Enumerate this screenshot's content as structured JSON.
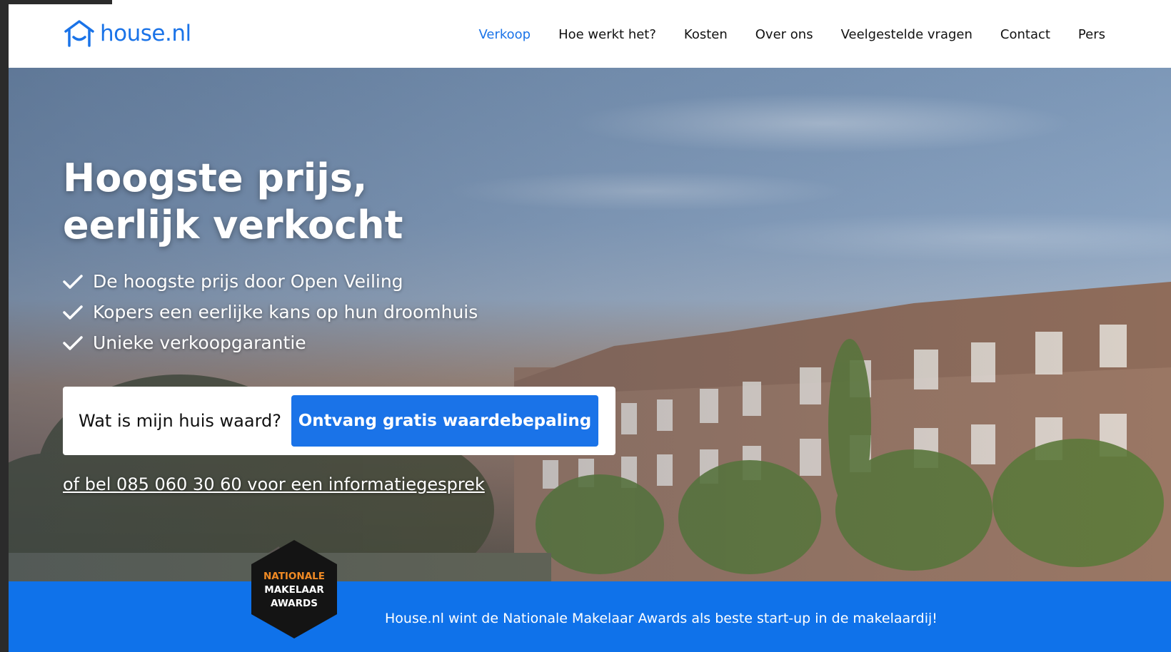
{
  "logo": {
    "text": "house.nl",
    "icon": "house-icon"
  },
  "nav": {
    "items": [
      {
        "label": "Verkoop",
        "active": true
      },
      {
        "label": "Hoe werkt het?",
        "active": false
      },
      {
        "label": "Kosten",
        "active": false
      },
      {
        "label": "Over ons",
        "active": false
      },
      {
        "label": "Veelgestelde vragen",
        "active": false
      },
      {
        "label": "Contact",
        "active": false
      },
      {
        "label": "Pers",
        "active": false
      }
    ]
  },
  "hero": {
    "headline_line1": "Hoogste prijs,",
    "headline_line2": "eerlijk verkocht",
    "features": [
      "De hoogste prijs door Open Veiling",
      "Kopers een eerlijke kans op hun droomhuis",
      "Unieke verkoopgarantie"
    ],
    "cta": {
      "label": "Wat is mijn huis waard?",
      "button": "Ontvang gratis waardebepaling"
    },
    "phone_link": "of bel 085 060 30 60 voor een informatiegesprek"
  },
  "award": {
    "line1": "NATIONALE",
    "line2": "MAKELAAR",
    "line3": "AWARDS"
  },
  "banner": {
    "text": "House.nl wint de Nationale Makelaar Awards als beste start-up in de makelaardij!"
  },
  "colors": {
    "brand_blue": "#1a73e8",
    "banner_blue": "#0f72ea",
    "award_orange": "#f08a24"
  }
}
